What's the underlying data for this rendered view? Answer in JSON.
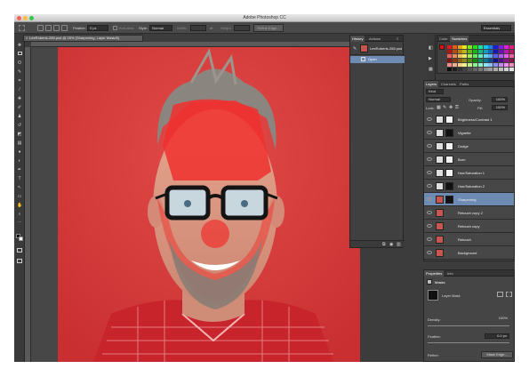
{
  "app": {
    "title": "Adobe Photoshop CC"
  },
  "options_bar": {
    "feather_label": "Feather:",
    "feather_value": "0 px",
    "anti_alias_label": "Anti-alias",
    "style_label": "Style:",
    "style_value": "Normal",
    "width_label": "Width:",
    "height_label": "Height:",
    "refine_edge_label": "Refine Edge...",
    "workspace_value": "Essentials"
  },
  "document": {
    "tab_title": "LeeRoberts-285.psd @ 25% (Sharpening, Layer Mask/8)"
  },
  "history": {
    "tabs": [
      "History",
      "Actions"
    ],
    "snapshot": "LeeRoberts-285.psd",
    "items": [
      "Open"
    ]
  },
  "color_panel": {
    "tabs": [
      "Color",
      "Swatches"
    ],
    "active_tab": "Swatches"
  },
  "layers_panel": {
    "tabs": [
      "Layers",
      "Channels",
      "Paths"
    ],
    "filter_label": "Kind",
    "blend_mode": "Normal",
    "opacity_label": "Opacity:",
    "opacity_value": "100%",
    "lock_label": "Lock:",
    "fill_label": "Fill:",
    "fill_value": "100%",
    "layers": [
      {
        "name": "Brightness/Contrast 1",
        "icon": "sun-icon",
        "selected": false
      },
      {
        "name": "Vignette",
        "icon": "levels-icon",
        "selected": false
      },
      {
        "name": "Dodge",
        "icon": "curves-icon",
        "selected": false
      },
      {
        "name": "Burn",
        "icon": "curves-icon",
        "selected": false
      },
      {
        "name": "Hue/Saturation 1",
        "icon": "hue-icon",
        "selected": false
      },
      {
        "name": "Hue/Saturation 2",
        "icon": "hue-icon",
        "selected": false
      },
      {
        "name": "Sharpening",
        "icon": "photo-icon",
        "selected": true
      },
      {
        "name": "Retouch copy 2",
        "icon": "photo-icon",
        "selected": false
      },
      {
        "name": "Retouch copy",
        "icon": "photo-icon",
        "selected": false
      },
      {
        "name": "Retouch",
        "icon": "photo-icon",
        "selected": false
      },
      {
        "name": "Background",
        "icon": "photo-icon",
        "selected": false
      }
    ]
  },
  "properties_panel": {
    "tabs": [
      "Properties",
      "Info"
    ],
    "section": "Masks",
    "mask_type": "Layer Mask",
    "density_label": "Density:",
    "density_value": "100%",
    "feather_label": "Feather:",
    "feather_value": "0.0 px",
    "refine_label": "Refine:",
    "mask_edge_button": "Mask Edge..."
  },
  "colors": {
    "accent": "#6e8bb3",
    "background_red": "#d63a3a",
    "mask_overlay": "#f0302e"
  }
}
